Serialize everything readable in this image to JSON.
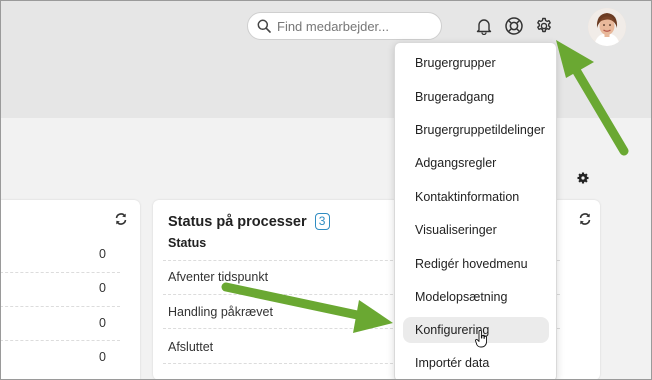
{
  "header": {
    "search": {
      "placeholder": "Find medarbejder..."
    }
  },
  "left_card": {
    "values": [
      "0",
      "0",
      "0",
      "0"
    ]
  },
  "process_card": {
    "title": "Status på processer",
    "count": "3",
    "column_header": "Status",
    "items": [
      "Afventer tidspunkt",
      "Handling påkrævet",
      "Afsluttet"
    ]
  },
  "settings_menu": {
    "items": [
      "Brugergrupper",
      "Brugeradgang",
      "Brugergruppetildelinger",
      "Adgangsregler",
      "Kontaktinformation",
      "Visualiseringer",
      "Redigér hovedmenu",
      "Modelopsætning",
      "Konfigurering",
      "Importér data"
    ],
    "hovered_item": "Konfigurering"
  },
  "colors": {
    "arrow": "#6aa832",
    "badge": "#2f8cc2",
    "topbar": "#e6e6e6",
    "menu_hover": "#ebebeb"
  },
  "icons": [
    "search-icon",
    "bell-icon",
    "help-lifebuoy-icon",
    "gear-icon",
    "refresh-icon",
    "hand-cursor-icon"
  ]
}
